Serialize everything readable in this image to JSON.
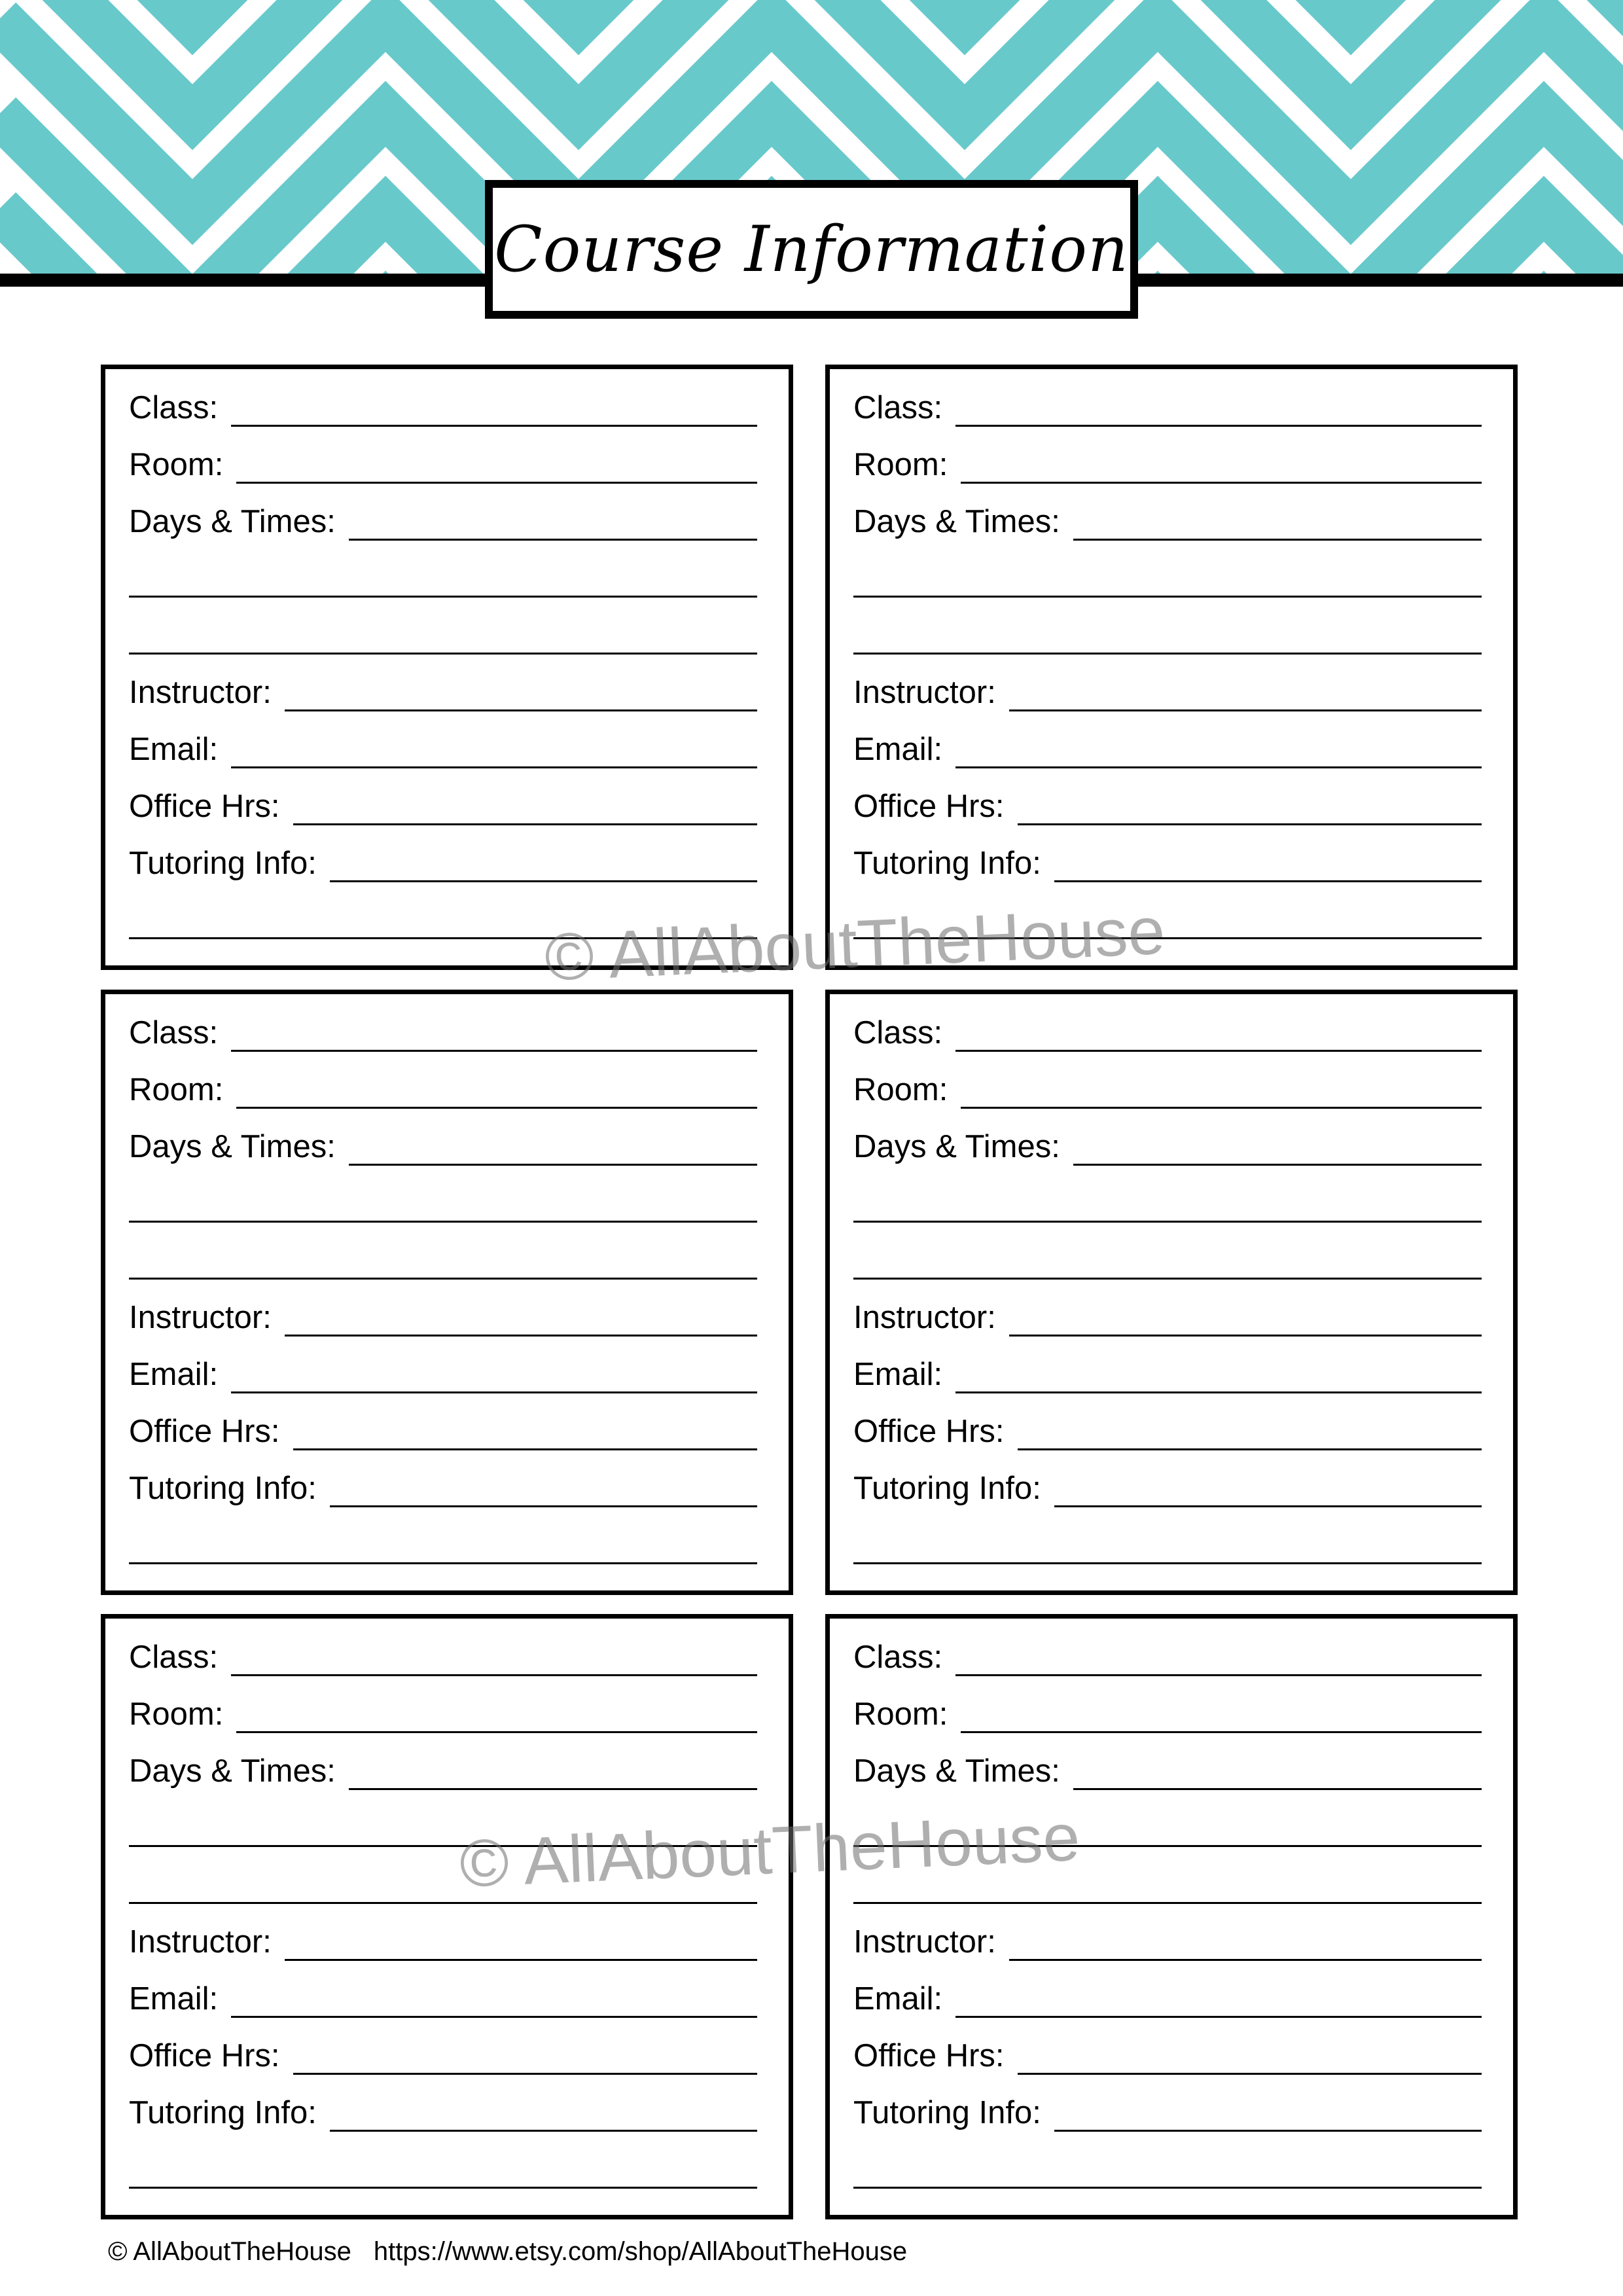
{
  "header": {
    "title": "Course Information",
    "accent_color": "#68c9cb"
  },
  "cards": [
    {
      "fields": [
        "Class:",
        "Room:",
        "Days & Times:",
        "",
        "",
        "Instructor:",
        "Email:",
        "Office Hrs:",
        "Tutoring Info:",
        ""
      ]
    },
    {
      "fields": [
        "Class:",
        "Room:",
        "Days & Times:",
        "",
        "",
        "Instructor:",
        "Email:",
        "Office Hrs:",
        "Tutoring Info:",
        ""
      ]
    },
    {
      "fields": [
        "Class:",
        "Room:",
        "Days & Times:",
        "",
        "",
        "Instructor:",
        "Email:",
        "Office Hrs:",
        "Tutoring Info:",
        ""
      ]
    },
    {
      "fields": [
        "Class:",
        "Room:",
        "Days & Times:",
        "",
        "",
        "Instructor:",
        "Email:",
        "Office Hrs:",
        "Tutoring Info:",
        ""
      ]
    },
    {
      "fields": [
        "Class:",
        "Room:",
        "Days & Times:",
        "",
        "",
        "Instructor:",
        "Email:",
        "Office Hrs:",
        "Tutoring Info:",
        ""
      ]
    },
    {
      "fields": [
        "Class:",
        "Room:",
        "Days & Times:",
        "",
        "",
        "Instructor:",
        "Email:",
        "Office Hrs:",
        "Tutoring Info:",
        ""
      ]
    }
  ],
  "watermarks": [
    "© AllAboutTheHouse",
    "© AllAboutTheHouse"
  ],
  "footer": {
    "copyright": "© AllAboutTheHouse",
    "url": "https://www.etsy.com/shop/AllAboutTheHouse"
  }
}
